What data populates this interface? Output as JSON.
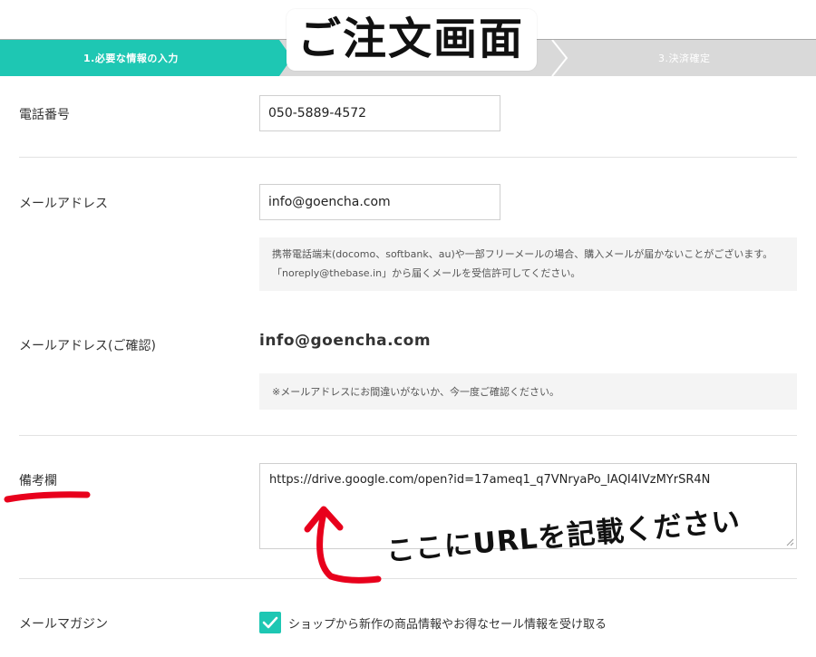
{
  "steps": [
    {
      "label": "1.必要な情報の入力",
      "active": true
    },
    {
      "label": "3.決済確定",
      "active": false
    }
  ],
  "overlay_title": "ご注文画面",
  "form": {
    "phone": {
      "label": "電話番号",
      "value": "050-5889-4572"
    },
    "email": {
      "label": "メールアドレス",
      "value": "info@goencha.com",
      "note": "携帯電話端末(docomo、softbank、au)や一部フリーメールの場合、購入メールが届かないことがございます。「noreply@thebase.in」から届くメールを受信許可してください。"
    },
    "email_confirm": {
      "label": "メールアドレス(ご確認)",
      "value": "info@goencha.com",
      "note": "※メールアドレスにお間違いがないか、今一度ご確認ください。"
    },
    "remarks": {
      "label": "備考欄",
      "value": "https://drive.google.com/open?id=17ameq1_q7VNryaPo_IAQI4IVzMYrSR4N"
    },
    "newsletter": {
      "label": "メールマガジン",
      "checkbox_label": "ショップから新作の商品情報やお得なセール情報を受け取る",
      "checked": true
    }
  },
  "annotation": {
    "text": "ここにURLを記載ください",
    "color": "#e8001c"
  },
  "colors": {
    "accent": "#1ec7b3",
    "stepbar_inactive": "#d9d9d9"
  }
}
